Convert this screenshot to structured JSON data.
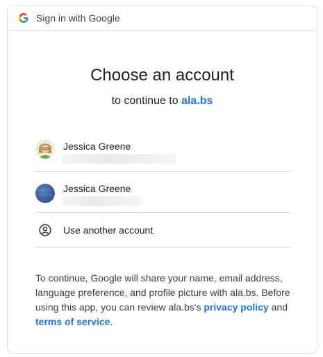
{
  "header": {
    "title": "Sign in with Google"
  },
  "main": {
    "title": "Choose an account",
    "subtitle_prefix": "to continue to ",
    "subtitle_link": "ala.bs"
  },
  "accounts": [
    {
      "name": "Jessica Greene",
      "avatar_icon": "avatar-illustrated-woman-icon"
    },
    {
      "name": "Jessica Greene",
      "avatar_icon": "avatar-blue-denim-icon"
    }
  ],
  "use_another": {
    "label": "Use another account",
    "icon": "account-circle-icon"
  },
  "footer": {
    "text_part1": "To continue, Google will share your name, email address, language preference, and profile picture with ala.bs. Before using this app, you can review ala.bs's ",
    "privacy_link": "privacy policy",
    "text_part2": " and ",
    "terms_link": "terms of service",
    "text_part3": "."
  },
  "colors": {
    "link": "#1a73e8",
    "border": "#dadce0",
    "text": "#202124"
  }
}
